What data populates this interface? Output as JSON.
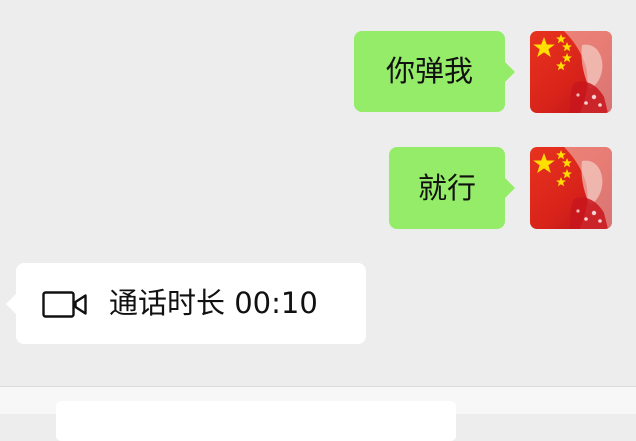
{
  "messages": [
    {
      "sender": "me",
      "text": "你弹我"
    },
    {
      "sender": "me",
      "text": "就行"
    },
    {
      "sender": "other",
      "type": "video-call-record",
      "icon": "video-camera-icon",
      "text": "通话时长 00:10"
    }
  ],
  "colors": {
    "chat_background": "#EDEDED",
    "outgoing_bubble": "#95EC69",
    "incoming_bubble": "#FFFFFF",
    "text": "#111111",
    "avatar_flag_red": "#DE2910",
    "avatar_flag_star": "#FFDE00"
  }
}
